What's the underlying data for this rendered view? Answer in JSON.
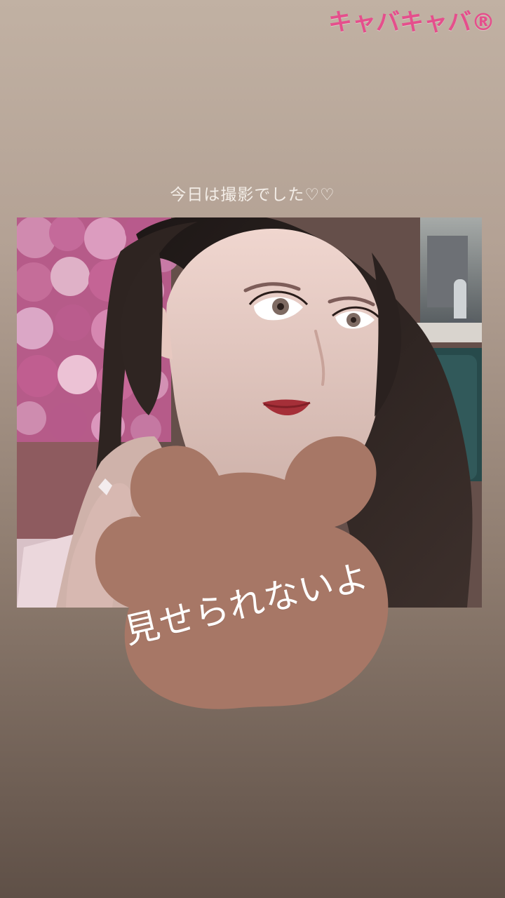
{
  "brand": {
    "label": "キャバキャバ®"
  },
  "story": {
    "caption": "今日は撮影でした♡♡",
    "sticker_text": "見せられないよ"
  },
  "colors": {
    "brand": "#e54f8c",
    "background_top": "#c1b1a3",
    "background_bottom": "#5f5047",
    "sticker": "#a77766"
  }
}
